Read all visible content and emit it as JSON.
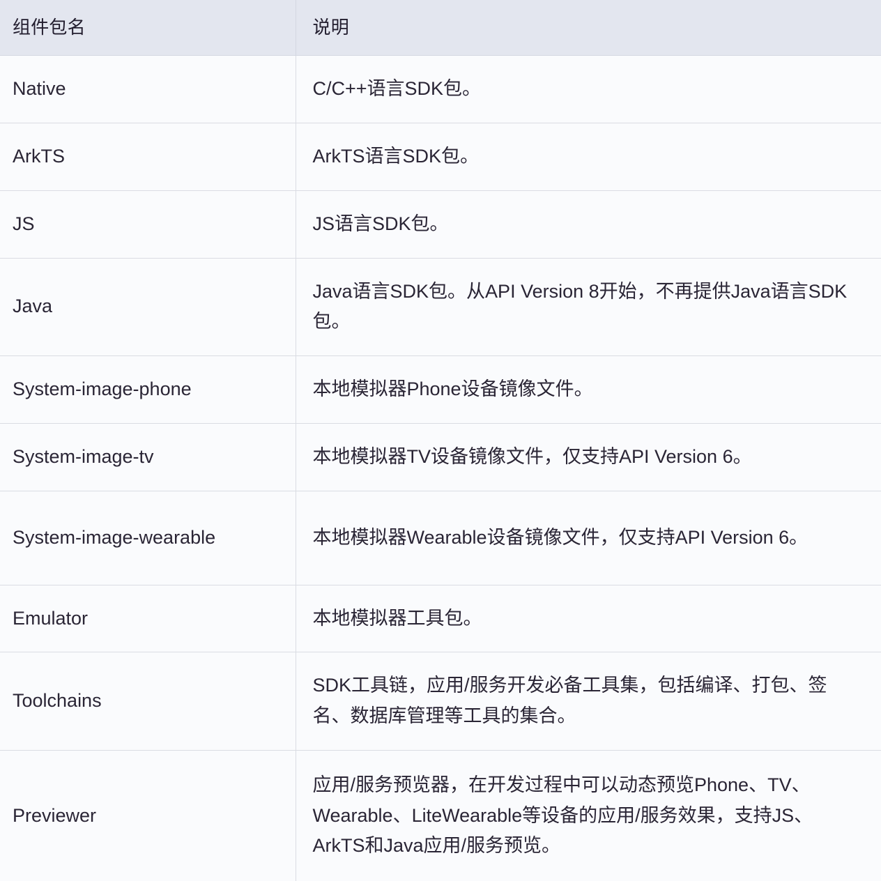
{
  "table": {
    "columns": [
      {
        "key": "name",
        "label": "组件包名"
      },
      {
        "key": "desc",
        "label": "说明"
      }
    ],
    "rows": [
      {
        "name": "Native",
        "desc": "C/C++语言SDK包。"
      },
      {
        "name": "ArkTS",
        "desc": "ArkTS语言SDK包。"
      },
      {
        "name": "JS",
        "desc": "JS语言SDK包。"
      },
      {
        "name": "Java",
        "desc": "Java语言SDK包。从API Version 8开始，不再提供Java语言SDK包。"
      },
      {
        "name": "System-image-phone",
        "desc": "本地模拟器Phone设备镜像文件。"
      },
      {
        "name": "System-image-tv",
        "desc": "本地模拟器TV设备镜像文件，仅支持API Version 6。"
      },
      {
        "name": "System-image-wearable",
        "desc": "本地模拟器Wearable设备镜像文件，仅支持API Version 6。"
      },
      {
        "name": "Emulator",
        "desc": "本地模拟器工具包。"
      },
      {
        "name": "Toolchains",
        "desc": "SDK工具链，应用/服务开发必备工具集，包括编译、打包、签名、数据库管理等工具的集合。"
      },
      {
        "name": "Previewer",
        "desc": "应用/服务预览器，在开发过程中可以动态预览Phone、TV、Wearable、LiteWearable等设备的应用/服务效果，支持JS、ArkTS和Java应用/服务预览。"
      }
    ]
  },
  "colors": {
    "header_background": "#e3e6ef",
    "body_background": "#fafbfd",
    "border": "#dadce3",
    "header_border": "#d3d7e2",
    "text": "#2a2535",
    "header_text": "#221d2e"
  }
}
